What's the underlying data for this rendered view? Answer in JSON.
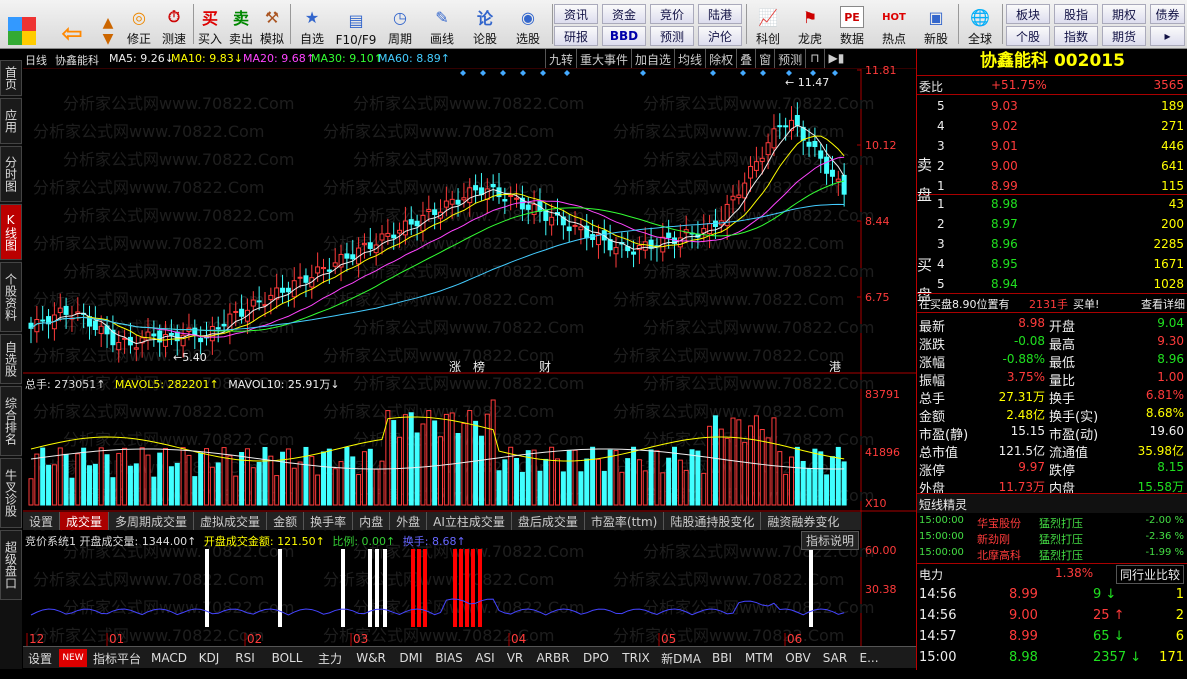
{
  "toolbar": {
    "items": [
      "修正",
      "测速",
      "买入",
      "卖出",
      "模拟",
      "自选",
      "F10/F9",
      "周期",
      "画线",
      "论股",
      "选股",
      "科创",
      "龙虎",
      "数据",
      "热点",
      "新股",
      "全球"
    ],
    "small": [
      "资讯",
      "资金",
      "竞价",
      "陆港",
      "研报",
      "BBD",
      "预测",
      "沪伦",
      "板块",
      "股指",
      "期权",
      "债券",
      "个股",
      "指数",
      "期货"
    ]
  },
  "sidebar": [
    "首页",
    "应用",
    "分时图",
    "K线图",
    "个股资料",
    "自选股",
    "综合排名",
    "牛叉诊股",
    "超级盘口"
  ],
  "chart": {
    "header_label": "日线",
    "stock_name": "协鑫能科",
    "ma5": "MA5: 9.26↓",
    "ma10": "MA10: 9.83↓",
    "ma20": "MA20: 9.68↑",
    "ma30": "MA30: 9.10↑",
    "ma60": "MA60: 8.89↑",
    "buttons": [
      "九转",
      "重大事件",
      "加自选",
      "均线",
      "除权",
      "叠",
      "窗",
      "预测"
    ],
    "price_ticks": [
      "11.81",
      "10.12",
      "8.44",
      "6.75"
    ],
    "high_label": "11.47",
    "low_label": "5.40",
    "markers": [
      "涨",
      "榜",
      "财",
      "港"
    ]
  },
  "volume": {
    "total": "总手: 273051↑",
    "mavol5": "MAVOL5: 282201↑",
    "mavol10": "MAVOL10: 25.91万↓",
    "ticks": [
      "83791",
      "41896",
      "X10"
    ]
  },
  "tabs": [
    "设置",
    "成交量",
    "多周期成交量",
    "虚拟成交量",
    "金额",
    "换手率",
    "内盘",
    "外盘",
    "AI立柱成交量",
    "盘后成交量",
    "市盈率(ttm)",
    "陆股通持股变化",
    "融资融券变化"
  ],
  "auction": {
    "label": "竞价系统1 开盘成交量: 1344.00↑",
    "amount": "开盘成交金额: 121.50↑",
    "ratio": "比例: 0.00↑",
    "turnover": "换手: 8.68↑",
    "explain": "指标说明",
    "ticks": [
      "60.00",
      "30.38"
    ]
  },
  "months": [
    "12",
    "01",
    "02",
    "03",
    "04",
    "05",
    "06"
  ],
  "bottom_tabs": [
    "设置",
    "NEW",
    "指标平台",
    "MACD",
    "KDJ",
    "RSI",
    "BOLL",
    "主力",
    "W&R",
    "DMI",
    "BIAS",
    "ASI",
    "VR",
    "ARBR",
    "DPO",
    "TRIX",
    "新DMA",
    "BBI",
    "MTM",
    "OBV",
    "SAR",
    "E..."
  ],
  "quote": {
    "title": "协鑫能科 002015",
    "weibi_label": "委比",
    "weibi": "+51.75%",
    "weicha": "3565",
    "sell_label": [
      "卖",
      "盘"
    ],
    "buy_label": [
      "买",
      "盘"
    ],
    "sells": [
      [
        "5",
        "9.03",
        "189"
      ],
      [
        "4",
        "9.02",
        "271"
      ],
      [
        "3",
        "9.01",
        "446"
      ],
      [
        "2",
        "9.00",
        "641"
      ],
      [
        "1",
        "8.99",
        "115"
      ]
    ],
    "buys": [
      [
        "1",
        "8.98",
        "43"
      ],
      [
        "2",
        "8.97",
        "200"
      ],
      [
        "3",
        "8.96",
        "2285"
      ],
      [
        "4",
        "8.95",
        "1671"
      ],
      [
        "5",
        "8.94",
        "1028"
      ]
    ],
    "notice": "在买盘8.90位置有",
    "notice_vol": "2131手",
    "notice_tag": "买单!",
    "notice_link": "查看详细",
    "stats": [
      [
        "最新",
        "8.98",
        "开盘",
        "9.04"
      ],
      [
        "涨跌",
        "-0.08",
        "最高",
        "9.30"
      ],
      [
        "涨幅",
        "-0.88%",
        "最低",
        "8.96"
      ],
      [
        "振幅",
        "3.75%",
        "量比",
        "1.00"
      ],
      [
        "总手",
        "27.31万",
        "换手",
        "6.81%"
      ],
      [
        "金额",
        "2.48亿",
        "换手(实)",
        "8.68%"
      ],
      [
        "市盈(静)",
        "15.15",
        "市盈(动)",
        "19.60"
      ],
      [
        "总市值",
        "121.5亿",
        "流通值",
        "35.98亿"
      ],
      [
        "涨停",
        "9.97",
        "跌停",
        "8.15"
      ],
      [
        "外盘",
        "11.73万",
        "内盘",
        "15.58万"
      ]
    ],
    "spirit_title": "短线精灵",
    "spirits": [
      [
        "15:00:00",
        "华宝股份",
        "猛烈打压",
        "-2.00 %"
      ],
      [
        "15:00:00",
        "新劲刚",
        "猛烈打压",
        "-2.36 %"
      ],
      [
        "15:00:00",
        "北摩高科",
        "猛烈打压",
        "-1.99 %"
      ]
    ],
    "industry": "电力",
    "industry_pct": "1.38%",
    "compare": "同行业比较",
    "ticks": [
      [
        "14:56",
        "8.99",
        "9",
        "1"
      ],
      [
        "14:56",
        "9.00",
        "25",
        "2"
      ],
      [
        "14:57",
        "8.99",
        "65",
        "6"
      ],
      [
        "15:00",
        "8.98",
        "2357",
        "171"
      ]
    ]
  },
  "watermark": "分析家公式网www.70822.Com"
}
